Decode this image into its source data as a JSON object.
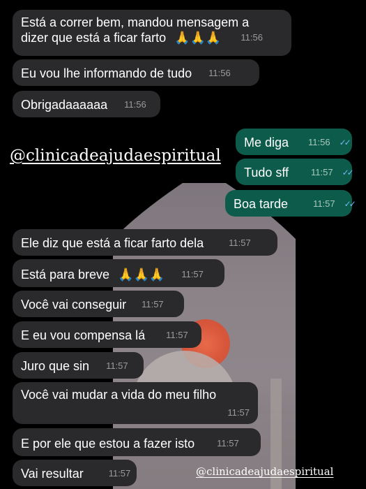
{
  "messages": [
    {
      "text": "Está a correr bem, mandou mensagem a",
      "text2": "dizer que está a ficar farto",
      "emoji": "🙏🙏🙏",
      "time": "11:56"
    },
    {
      "text": "Eu vou lhe informando de tudo",
      "time": "11:56"
    },
    {
      "text": "Obrigadaaaaaa",
      "time": "11:56"
    },
    {
      "text": "Me diga",
      "time": "11:56",
      "ticks": "✓✓"
    },
    {
      "text": "Tudo sff",
      "time": "11:57",
      "ticks": "✓✓"
    },
    {
      "text": "Boa tarde",
      "time": "11:57",
      "ticks": "✓✓"
    },
    {
      "text": "Ele diz que está a ficar farto dela",
      "time": "11:57"
    },
    {
      "text": "Está para breve",
      "emoji": "🙏🙏🙏",
      "time": "11:57"
    },
    {
      "text": "Você vai conseguir",
      "time": "11:57"
    },
    {
      "text": "E eu vou compensa lá",
      "time": "11:57"
    },
    {
      "text": "Juro que sin",
      "time": "11:57"
    },
    {
      "text": "Você vai mudar a vida do meu filho",
      "time": "11:57"
    },
    {
      "text": "E por ele que estou a fazer isto",
      "time": "11:57"
    },
    {
      "text": "Vai resultar",
      "time": "11:57"
    }
  ],
  "watermark_large": "@clinicadeajudaespiritual",
  "watermark_small": "@clinicadeajudaespiritual",
  "colors": {
    "incoming": "#2a2a2c",
    "outgoing": "#0d5c4b",
    "read_ticks": "#6cb8f5"
  }
}
